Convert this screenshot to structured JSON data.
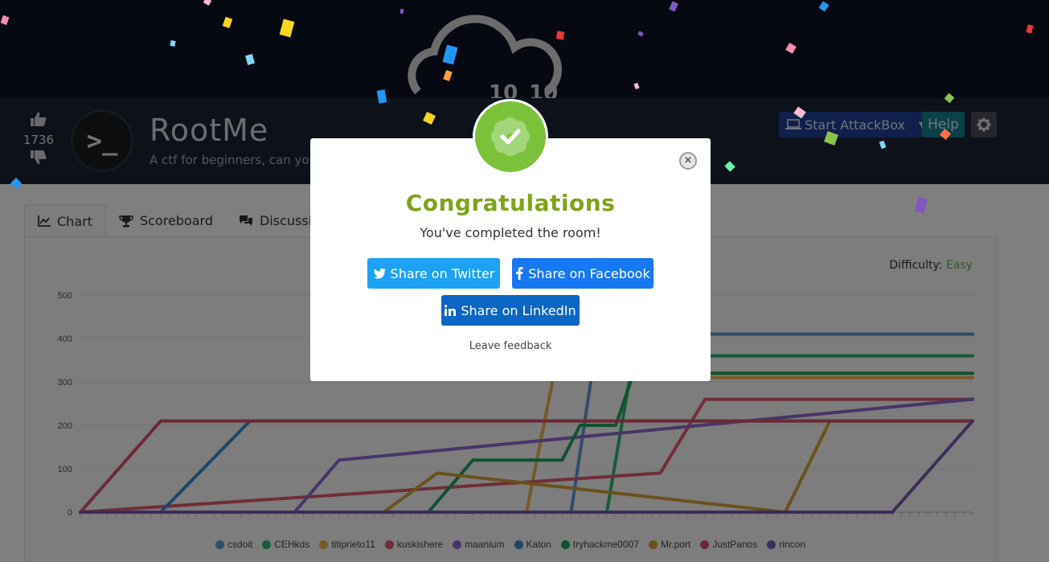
{
  "room": {
    "title": "RootMe",
    "description": "A ctf for beginners, can you root me?",
    "upvotes": "1736",
    "logo_text": ">_",
    "score_left": "10",
    "score_right": "10"
  },
  "toolbar": {
    "attackbox_label": "Start AttackBox",
    "help_label": "Help"
  },
  "tabs": [
    {
      "label": "Chart",
      "icon": "area-chart-icon"
    },
    {
      "label": "Scoreboard",
      "icon": "trophy-icon"
    },
    {
      "label": "Discussion",
      "icon": "comments-icon"
    }
  ],
  "difficulty": {
    "label": "Difficulty:",
    "value": "Easy",
    "color": "#6ab04c"
  },
  "modal": {
    "title": "Congratulations",
    "subtitle": "You've completed the room!",
    "twitter_label": "Share on Twitter",
    "facebook_label": "Share on Facebook",
    "linkedin_label": "Share on LinkedIn",
    "feedback_label": "Leave feedback",
    "close_label": "×"
  },
  "colors": {
    "accent_green": "#7cc13a",
    "twitter": "#1da1f2",
    "facebook": "#1877f2",
    "linkedin": "#0a66c2"
  },
  "chart_data": {
    "type": "line",
    "ylim": [
      0,
      500
    ],
    "yticks": [
      0,
      100,
      200,
      300,
      400,
      500
    ],
    "xlim": [
      0,
      100
    ],
    "grid": true,
    "legend": "bottom",
    "series": [
      {
        "name": "csdoit",
        "color": "#5b9bd5",
        "x": [
          0,
          55,
          58,
          100
        ],
        "y": [
          0,
          0,
          410,
          410
        ]
      },
      {
        "name": "CEHkds",
        "color": "#2eb872",
        "x": [
          0,
          59,
          62,
          100
        ],
        "y": [
          0,
          0,
          360,
          360
        ]
      },
      {
        "name": "titiprieto11",
        "color": "#f0b24d",
        "x": [
          0,
          50,
          53,
          100
        ],
        "y": [
          0,
          0,
          310,
          310
        ]
      },
      {
        "name": "kuskishere",
        "color": "#e05d6f",
        "x": [
          0,
          65,
          70,
          100
        ],
        "y": [
          0,
          90,
          260,
          260
        ]
      },
      {
        "name": "maanium",
        "color": "#8e6ad2",
        "x": [
          0,
          24,
          29,
          100
        ],
        "y": [
          0,
          0,
          120,
          260
        ]
      },
      {
        "name": "Katon",
        "color": "#3c8dcd",
        "x": [
          0,
          9,
          19,
          100
        ],
        "y": [
          0,
          0,
          210,
          210
        ]
      },
      {
        "name": "tryhackme0007",
        "color": "#1fa35c",
        "x": [
          0,
          39,
          44,
          54,
          56,
          60,
          62,
          100
        ],
        "y": [
          0,
          0,
          120,
          120,
          200,
          200,
          320,
          320
        ]
      },
      {
        "name": "Mr.port",
        "color": "#d4a23a",
        "x": [
          0,
          34,
          40,
          79,
          84,
          100
        ],
        "y": [
          0,
          0,
          90,
          0,
          210,
          210
        ]
      },
      {
        "name": "JustPanos",
        "color": "#d9536a",
        "x": [
          0,
          9,
          100
        ],
        "y": [
          0,
          210,
          210
        ]
      },
      {
        "name": "rincon",
        "color": "#7b5ab8",
        "x": [
          0,
          91,
          100
        ],
        "y": [
          0,
          0,
          210
        ]
      }
    ]
  }
}
